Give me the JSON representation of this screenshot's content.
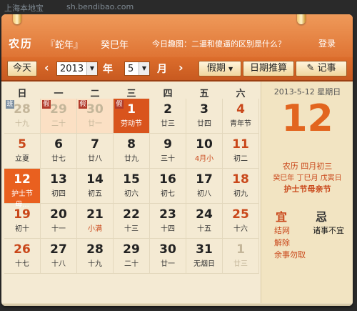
{
  "watermark": {
    "site": "上海本地宝",
    "url": "sh.bendibao.com"
  },
  "header": {
    "app_title": "农历",
    "zodiac_year": "『蛇年』",
    "ganzhi_year": "癸巳年",
    "daily_fun": "今日趣图：二逼和傻逼的区别是什么？",
    "login": "登录"
  },
  "toolbar": {
    "today": "今天",
    "year_value": "2013",
    "year_label": "年",
    "month_value": "5",
    "month_label": "月",
    "holidays": "假期",
    "date_calc": "日期推算",
    "notes": "记事",
    "prev_icon": "chevron-left-icon",
    "next_icon": "chevron-right-icon",
    "note_icon": "pencil-note-icon"
  },
  "weekdays": [
    "日",
    "一",
    "二",
    "三",
    "四",
    "五",
    "六"
  ],
  "weeks": [
    [
      {
        "n": "28",
        "l": "十九",
        "o": true,
        "b": "班",
        "bt": "ban"
      },
      {
        "n": "29",
        "l": "二十",
        "o": true,
        "b": "假",
        "hl": true
      },
      {
        "n": "30",
        "l": "廿一",
        "o": true,
        "b": "假",
        "hl": true
      },
      {
        "n": "1",
        "l": "劳动节",
        "b": "假",
        "red": true
      },
      {
        "n": "2",
        "l": "廿三"
      },
      {
        "n": "3",
        "l": "廿四"
      },
      {
        "n": "4",
        "l": "青年节",
        "w": true
      }
    ],
    [
      {
        "n": "5",
        "l": "立夏",
        "w": true
      },
      {
        "n": "6",
        "l": "廿七"
      },
      {
        "n": "7",
        "l": "廿八"
      },
      {
        "n": "8",
        "l": "廿九"
      },
      {
        "n": "9",
        "l": "三十"
      },
      {
        "n": "10",
        "l": "4月小",
        "sp": true
      },
      {
        "n": "11",
        "l": "初二",
        "w": true
      }
    ],
    [
      {
        "n": "12",
        "l": "护士节 母...",
        "today": true
      },
      {
        "n": "13",
        "l": "初四"
      },
      {
        "n": "14",
        "l": "初五"
      },
      {
        "n": "15",
        "l": "初六"
      },
      {
        "n": "16",
        "l": "初七"
      },
      {
        "n": "17",
        "l": "初八"
      },
      {
        "n": "18",
        "l": "初九",
        "w": true
      }
    ],
    [
      {
        "n": "19",
        "l": "初十",
        "w": true
      },
      {
        "n": "20",
        "l": "十一"
      },
      {
        "n": "21",
        "l": "小满",
        "sp": true
      },
      {
        "n": "22",
        "l": "十三"
      },
      {
        "n": "23",
        "l": "十四"
      },
      {
        "n": "24",
        "l": "十五"
      },
      {
        "n": "25",
        "l": "十六",
        "w": true
      }
    ],
    [
      {
        "n": "26",
        "l": "十七",
        "w": true
      },
      {
        "n": "27",
        "l": "十八"
      },
      {
        "n": "28",
        "l": "十九"
      },
      {
        "n": "29",
        "l": "二十"
      },
      {
        "n": "30",
        "l": "廿一"
      },
      {
        "n": "31",
        "l": "无烟日"
      },
      {
        "n": "1",
        "l": "廿三",
        "o": true
      }
    ]
  ],
  "side": {
    "date_line": "2013-5-12 星期日",
    "big_day": "12",
    "lunar": "农历 四月初三",
    "ganzhi": "癸巳年 丁巳月 戊寅日",
    "festival": "护士节母亲节",
    "yi_label": "宜",
    "ji_label": "忌",
    "yi_items": [
      "结网",
      "解除",
      "余事勿取"
    ],
    "ji_items": [
      "诸事不宜"
    ]
  },
  "colors": {
    "accent": "#e9601f",
    "weekend": "#c9471a",
    "paper": "#f4ead3"
  }
}
